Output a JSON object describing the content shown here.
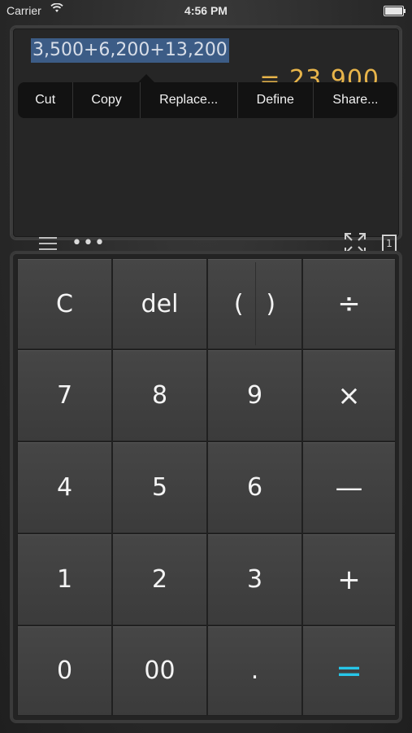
{
  "status_bar": {
    "carrier": "Carrier",
    "wifi_icon": "wifi-icon",
    "time": "4:56 PM",
    "battery_icon": "battery-icon"
  },
  "display": {
    "expression": "3,500+6,200+13,200",
    "result": "= 23,900",
    "context_menu": [
      "Cut",
      "Copy",
      "Replace...",
      "Define",
      "Share..."
    ],
    "tools": {
      "menu_icon": "hamburger-menu-icon",
      "more_icon": "more-dots-icon",
      "dots": "•••",
      "expand_icon": "expand-icon",
      "page_icon": "page-counter-icon",
      "page_number": "1"
    }
  },
  "keypad": {
    "rows": [
      [
        "C",
        "del",
        "( )",
        "÷"
      ],
      [
        "7",
        "8",
        "9",
        "×"
      ],
      [
        "4",
        "5",
        "6",
        "—"
      ],
      [
        "1",
        "2",
        "3",
        "+"
      ],
      [
        "0",
        "00",
        ".",
        "="
      ]
    ],
    "paren_left": "(",
    "paren_right": ")",
    "colors": {
      "equals": "#27c6e8",
      "result": "#e7b44a",
      "selection": "#3c5c86"
    }
  }
}
